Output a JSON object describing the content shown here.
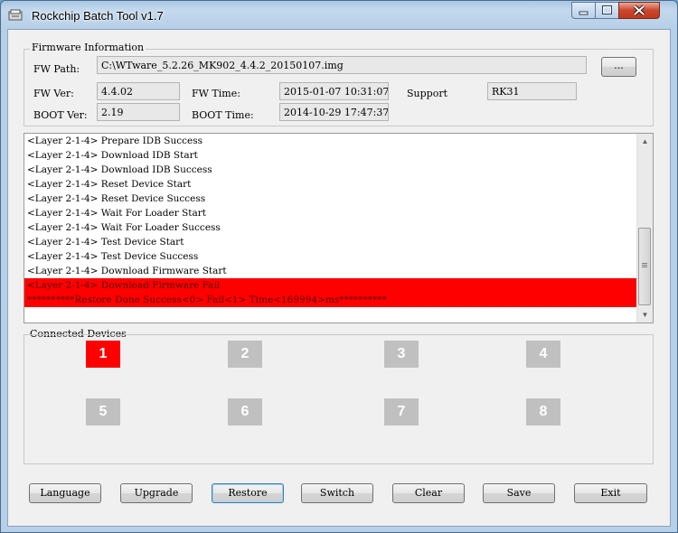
{
  "window": {
    "title": "Rockchip Batch Tool v1.7"
  },
  "firmware": {
    "legend": "Firmware Information",
    "fw_path_label": "FW Path:",
    "fw_path_value": "C:\\WTware_5.2.26_MK902_4.4.2_20150107.img",
    "browse_label": "...",
    "fw_ver_label": "FW Ver:",
    "fw_ver_value": "4.4.02",
    "fw_time_label": "FW Time:",
    "fw_time_value": "2015-01-07 10:31:07",
    "support_label": "Support",
    "support_value": "RK31",
    "boot_ver_label": "BOOT Ver:",
    "boot_ver_value": "2.19",
    "boot_time_label": "BOOT Time:",
    "boot_time_value": "2014-10-29 17:47:37"
  },
  "log": {
    "lines": [
      "<Layer 2-1-4> Prepare IDB Success",
      "<Layer 2-1-4> Download IDB Start",
      "<Layer 2-1-4> Download IDB Success",
      "<Layer 2-1-4> Reset Device Start",
      "<Layer 2-1-4> Reset Device Success",
      "<Layer 2-1-4> Wait For Loader Start",
      "<Layer 2-1-4> Wait For Loader Success",
      "<Layer 2-1-4> Test Device Start",
      "<Layer 2-1-4> Test Device Success",
      "<Layer 2-1-4> Download Firmware Start"
    ],
    "error_lines": [
      "<Layer 2-1-4> Download Firmware Fail",
      "**********Restore Done Success<0> Fail<1> Time<169994>ms**********"
    ]
  },
  "devices": {
    "legend": "Connected Devices",
    "slots": [
      "1",
      "2",
      "3",
      "4",
      "5",
      "6",
      "7",
      "8"
    ],
    "active_slot": "1",
    "colors": {
      "active": "#ff0000",
      "inactive": "#c0c0c0"
    }
  },
  "buttons": {
    "language": "Language",
    "upgrade": "Upgrade",
    "restore": "Restore",
    "switch": "Switch",
    "clear": "Clear",
    "save": "Save",
    "exit": "Exit"
  }
}
